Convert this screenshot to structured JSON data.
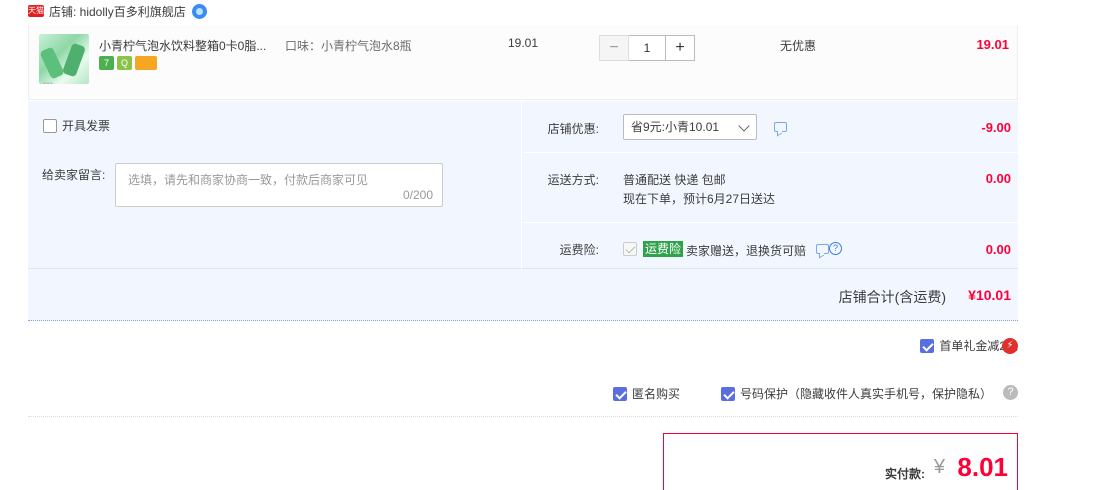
{
  "shop": {
    "badge": "天猫",
    "name": "店铺: hidolly百多利旗舰店"
  },
  "item": {
    "title": "小青柠气泡水饮料整箱0卡0脂...",
    "image_more": "---",
    "badges": [
      "7",
      "Q",
      ""
    ],
    "sku": "口味：小青柠气泡水8瓶",
    "price": "19.01",
    "quantity": "1",
    "qty_minus": "−",
    "qty_plus": "+",
    "discount": "无优惠",
    "total": "19.01"
  },
  "options": {
    "invoice_label": "开具发票",
    "message_label": "给卖家留言:",
    "message_placeholder": "选填，请先和商家协商一致，付款后商家可见",
    "message_count": "0/200",
    "shop_discount_label": "店铺优惠:",
    "shop_discount_selected": "省9元:小青10.01",
    "shop_discount_amount": "-9.00",
    "shipping_label": "运送方式:",
    "shipping_line1": "普通配送 快递 包邮",
    "shipping_line2": "现在下单，预计6月27日送达",
    "shipping_amount": "0.00",
    "insurance_label": "运费险:",
    "insurance_tag": "运费险",
    "insurance_text": "卖家赠送，退换货可赔",
    "insurance_amount": "0.00",
    "help_glyph": "?"
  },
  "subtotal": {
    "label": "店铺合计(含运费)",
    "amount": "¥10.01"
  },
  "gift": {
    "label": "首单礼金减2元",
    "checked": true
  },
  "privacy": {
    "anonymous_label": "匿名购买",
    "number_protect_label": "号码保护（隐藏收件人真实手机号，保护隐私）",
    "help_glyph": "?"
  },
  "payment": {
    "label": "实付款:",
    "currency": "¥",
    "amount": "8.01"
  },
  "colors": {
    "accent_red": "#ff0036",
    "panel_blue": "#f2f7ff",
    "checkbox_blue": "#5b6ee1",
    "insurance_green": "#2fa24b"
  }
}
